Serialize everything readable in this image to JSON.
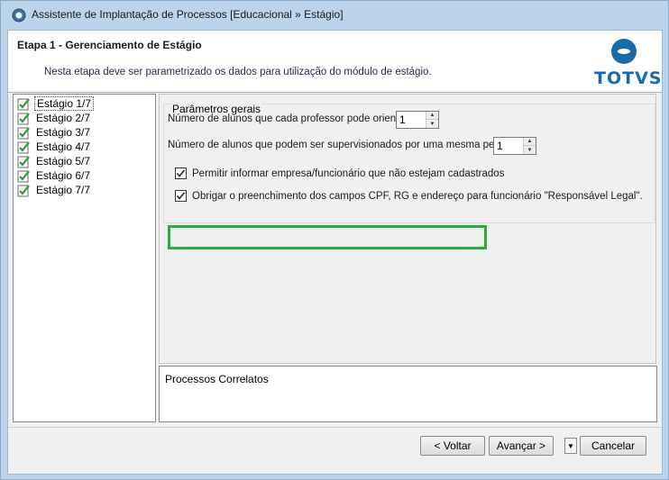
{
  "window": {
    "title": "Assistente de Implantação de Processos [Educacional » Estágio]"
  },
  "header": {
    "step_title": "Etapa 1 - Gerenciamento de Estágio",
    "description": "Nesta etapa deve ser parametrizado os dados para utilização do módulo de estágio.",
    "logo_text": "TOTVS",
    "accent_color": "#1b6aa8"
  },
  "steps": [
    {
      "label": "Estágio 1/7",
      "selected": true
    },
    {
      "label": "Estágio 2/7"
    },
    {
      "label": "Estágio 3/7"
    },
    {
      "label": "Estágio 4/7"
    },
    {
      "label": "Estágio 5/7"
    },
    {
      "label": "Estágio 6/7"
    },
    {
      "label": "Estágio 7/7"
    }
  ],
  "params": {
    "group_title": "Parâmetros gerais",
    "field1_label": "Número de alunos que cada professor pode orientar:",
    "field1_value": "1",
    "field2_label": "Número de alunos que podem ser supervisionados por uma mesma pessoa:",
    "field2_value": "1",
    "check1_label": "Permitir informar empresa/funcionário que não estejam cadastrados",
    "check1_checked": true,
    "check2_label": "Obrigar o preenchimento dos campos CPF, RG e endereço para funcionário \"Responsável Legal\".",
    "check2_checked": true,
    "highlight_color": "#2eab3e"
  },
  "related": {
    "title": "Processos Correlatos"
  },
  "buttons": {
    "back": "< Voltar",
    "next": "Avançar >",
    "cancel": "Cancelar"
  }
}
